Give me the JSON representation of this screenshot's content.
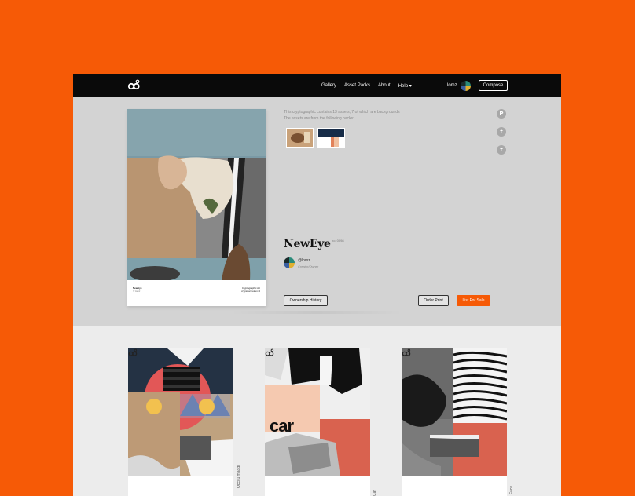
{
  "colors": {
    "accent": "#f65a06",
    "nav_bg": "#0a0a0a",
    "page_bg": "#d3d3d3",
    "gallery_bg": "#ececec"
  },
  "nav": {
    "logo_icon": "logo-icon",
    "links": [
      "Gallery",
      "Asset Packs",
      "About",
      "Help ▾"
    ],
    "username": "lomz",
    "compose_label": "Compose"
  },
  "hero": {
    "art_caption_left_1": "NewEye",
    "art_caption_left_2": "© lomz",
    "art_caption_right_1": "Cryptographic Art",
    "art_caption_right_2": "crypto art token id",
    "info_line_1": "This cryptographic contains 13 assets, 7 of which are backgrounds",
    "info_line_2": "The assets are from the following packs:",
    "title": "NewEye",
    "number": "no. 0098",
    "creator_name": "@lomz",
    "creator_role": "Creator/Owner",
    "ownership_history_label": "Ownership History",
    "order_print_label": "Order Print",
    "list_for_sale_label": "List For Sale"
  },
  "share": {
    "icons": [
      "pinterest-icon",
      "twitter-icon",
      "tumblr-icon"
    ],
    "glyphs": [
      "P",
      "t",
      "t"
    ]
  },
  "gallery": {
    "cards": [
      {
        "side_label": "Occi u maggi"
      },
      {
        "side_label": "Car"
      },
      {
        "side_label": "Face"
      }
    ],
    "car_text": "car"
  }
}
